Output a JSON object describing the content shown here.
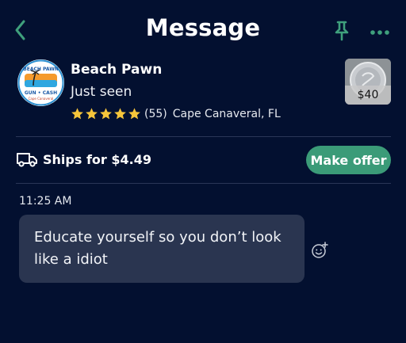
{
  "header": {
    "title": "Message",
    "back_icon": "chevron-left-icon",
    "pin_icon": "pin-icon",
    "more_icon": "more-dots-icon",
    "accent_color": "#3fa07c"
  },
  "seller": {
    "name": "Beach Pawn",
    "status": "Just seen",
    "rating_stars": 5,
    "rating_count": "(55)",
    "location": "Cape Canaveral, FL",
    "avatar_text": {
      "top": "BEACH PAWN",
      "middle": "GUN • CASH",
      "bottom": "Cape Canaveral"
    }
  },
  "listing": {
    "price": "$40"
  },
  "shipping": {
    "label": "Ships for $4.49",
    "icon": "truck-icon"
  },
  "offer_button": {
    "label": "Make offer",
    "color": "#3b9b78"
  },
  "messages": [
    {
      "time": "11:25 AM",
      "text": "Educate yourself so you don’t look like a idiot"
    }
  ],
  "reaction_icon": "add-reaction-icon"
}
